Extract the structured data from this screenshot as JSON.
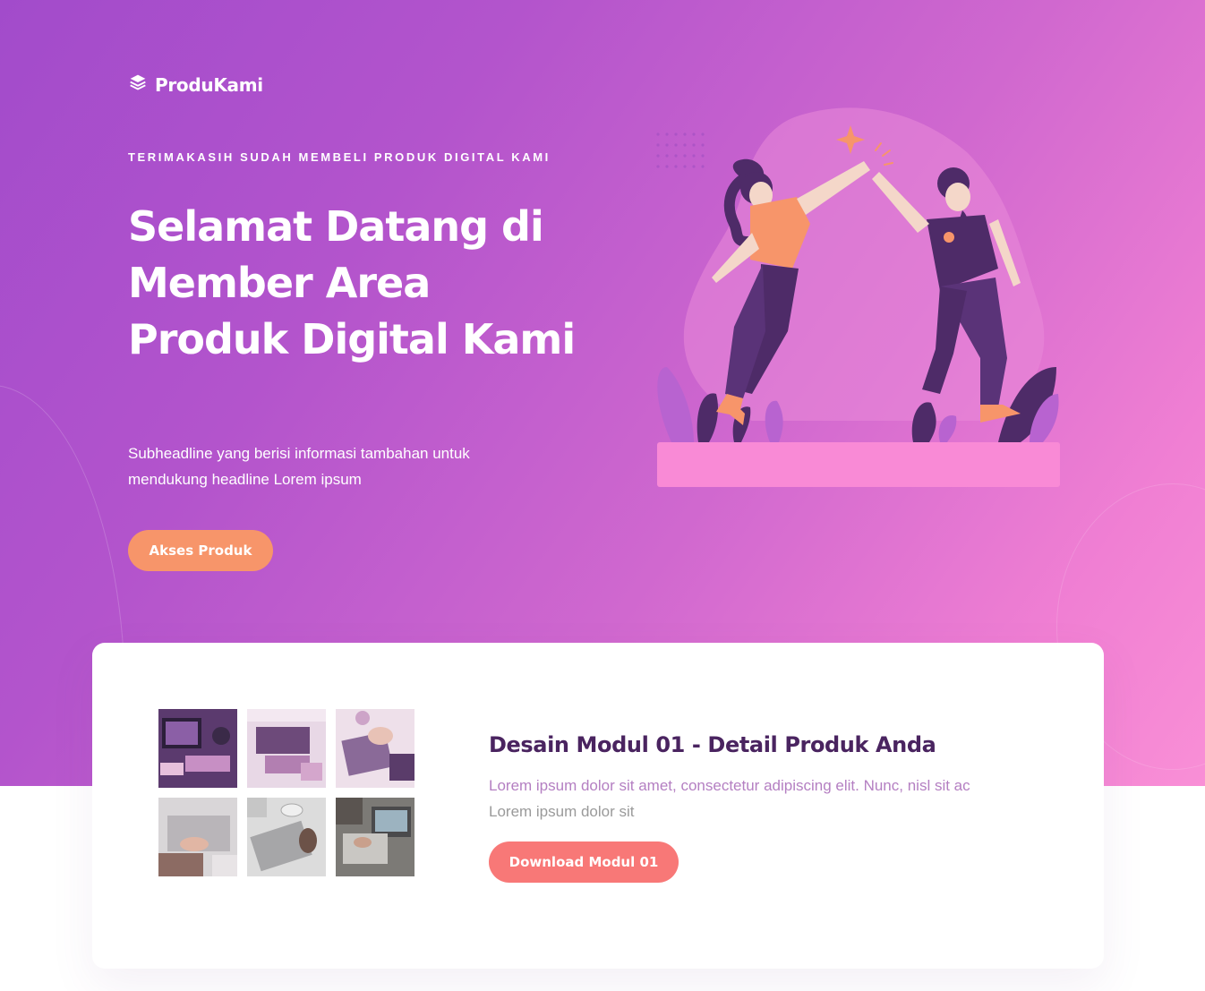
{
  "brand": {
    "name": "ProduKami",
    "icon": "layers-icon"
  },
  "hero": {
    "eyebrow": "TERIMAKASIH SUDAH MEMBELI PRODUK DIGITAL KAMI",
    "headline": "Selamat Datang di Member Area Produk Digital Kami",
    "subheadline": "Subheadline yang berisi informasi tambahan untuk mendukung headline Lorem ipsum",
    "cta_label": "Akses Produk",
    "illustration": "high-five-illustration"
  },
  "module": {
    "title": "Desain Modul 01 - Detail Produk Anda",
    "description_line1": "Lorem ipsum dolor sit amet, consectetur adipiscing elit. Nunc, nisl sit ac",
    "description_line2": "Lorem ipsum dolor sit",
    "download_label": "Download Modul 01",
    "thumbnails": [
      "desk-computer-photo",
      "workspace-photo",
      "laptop-typing-photo",
      "laptop-hands-photo",
      "coffee-laptop-photo",
      "laptop-meeting-photo"
    ]
  },
  "colors": {
    "hero_gradient_start": "#a24bcb",
    "hero_gradient_end": "#f98fd6",
    "accent_orange": "#f7956a",
    "accent_coral": "#f87877",
    "title_purple": "#4a2460"
  }
}
